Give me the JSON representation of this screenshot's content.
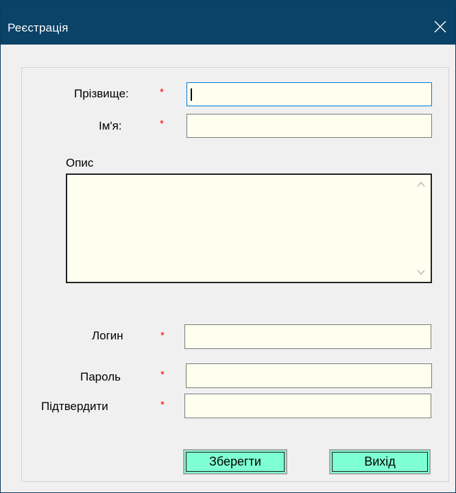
{
  "window": {
    "title": "Реєстрація",
    "close_symbol": "✕"
  },
  "form": {
    "surname_label": "Прізвище:",
    "name_label": "Ім'я:",
    "description_label": "Опис",
    "login_label": "Логин",
    "password_label": "Пароль",
    "confirm_label": "Підтвердити",
    "required_mark": "*",
    "surname_value": "",
    "name_value": "",
    "description_value": "",
    "login_value": "",
    "password_value": "",
    "confirm_value": ""
  },
  "buttons": {
    "save_label": "Зберегти",
    "exit_label": "Вихід"
  },
  "colors": {
    "titlebar": "#0b4267",
    "field_background": "#fffff0",
    "button_background": "#7fffd4",
    "required": "#ff0000",
    "focus_border": "#0078d7"
  }
}
